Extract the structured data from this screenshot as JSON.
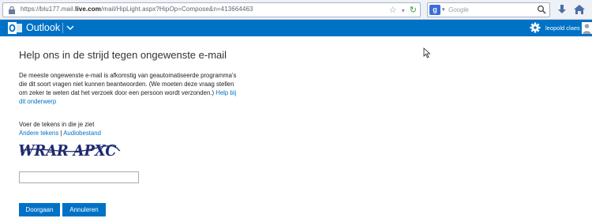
{
  "browser": {
    "url_prefix": "https://blu177.mail.",
    "url_domain": "live.com",
    "url_rest": "/mail/HipLight.aspx?HipOp=Compose&n=413664463",
    "search_placeholder": "Google"
  },
  "header": {
    "app_name": "Outlook",
    "user_name": "leopold claes",
    "brand_color": "#0072c6"
  },
  "main": {
    "title": "Help ons in de strijd tegen ongewenste e-mail",
    "intro_text": "De meeste ongewenste e-mail is afkomstig van geautomatiseerde programma's die dit soort vragen niet kunnen beantwoorden. (We moeten deze vraag stellen om zeker te weten dat het verzoek door een persoon wordt verzonden.) ",
    "help_link": "Help bij dit onderwerp",
    "captcha_prompt": "Voer de tekens in die je ziet",
    "other_chars_link": "Andere tekens",
    "separator": "|",
    "audio_link": "Audiobestand",
    "captcha_text": "WRAR APXC",
    "captcha_value": "",
    "submit_label": "Doorgaan",
    "cancel_label": "Annuleren"
  }
}
